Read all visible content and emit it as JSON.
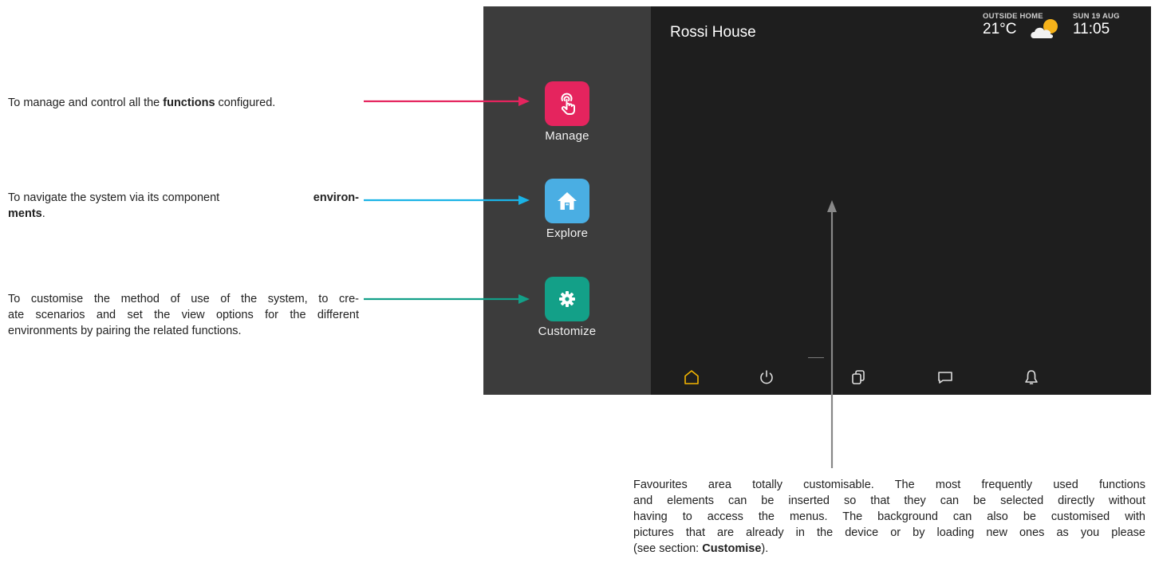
{
  "annotations": {
    "manage": {
      "before": "To manage and control all the ",
      "bold": "functions",
      "after": " configured."
    },
    "explore": {
      "before": "To navigate the system via its component ",
      "bold": "environ-",
      "bold2": "ments",
      "after": "."
    },
    "customize": {
      "line1": "To customise the method of use of the system, to cre-",
      "line2": "ate scenarios and set the view options for the different",
      "line3": "environments by pairing the related functions."
    },
    "favourites": {
      "line1": "Favourites area totally customisable. The most frequently used functions",
      "line2": "and elements can be inserted so that they can be selected directly without",
      "line3": "having to access the menus. The background can also be customised with",
      "line4": "pictures that are already in the device or by loading new ones as you please",
      "line5_before": "(see section: ",
      "line5_bold": "Customise",
      "line5_after": ")."
    }
  },
  "device": {
    "title": "Rossi House",
    "weather_label": "OUTSIDE HOME",
    "temperature": "21°C",
    "weather_icon": "partly-cloudy-icon",
    "date": "SUN 19 AUG",
    "time": "11:05",
    "apps": [
      {
        "label": "Manage",
        "icon": "hand-tap-icon",
        "color": "#e5245e"
      },
      {
        "label": "Explore",
        "icon": "house-icon",
        "color": "#4aaee3"
      },
      {
        "label": "Customize",
        "icon": "gear-icon",
        "color": "#13a088"
      }
    ],
    "nav": [
      {
        "name": "home",
        "icon": "home-icon",
        "color": "#f2b400"
      },
      {
        "name": "power",
        "icon": "power-icon",
        "color": "#dddddd"
      },
      {
        "name": "windows",
        "icon": "windows-icon",
        "color": "#dddddd"
      },
      {
        "name": "messages",
        "icon": "message-icon",
        "color": "#dddddd"
      },
      {
        "name": "notifications",
        "icon": "bell-icon",
        "color": "#dddddd"
      }
    ]
  },
  "colors": {
    "manage_arrow": "#e5245e",
    "explore_arrow": "#1ab3e6",
    "customize_arrow": "#13a088",
    "favourites_arrow": "#888888"
  }
}
